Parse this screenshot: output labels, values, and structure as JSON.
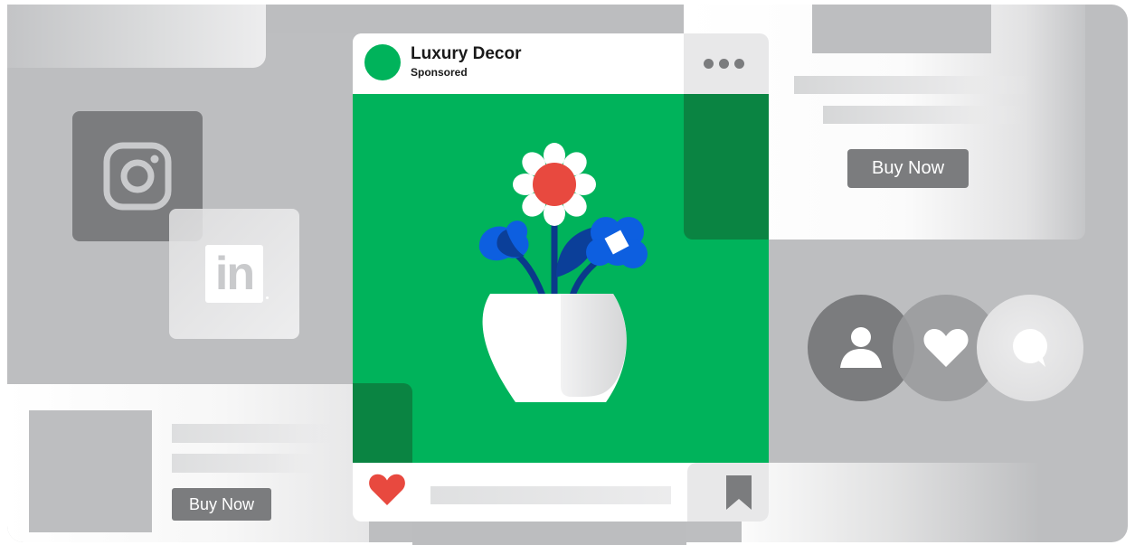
{
  "post": {
    "brand_name": "Luxury Decor",
    "sponsored_label": "Sponsored",
    "image_alt": "Flowers in a white vase",
    "actions": {
      "like_icon": "heart-icon",
      "save_icon": "bookmark-icon",
      "more_icon": "more-options-icon"
    }
  },
  "side_ads": {
    "top_right_button": "Buy Now",
    "bottom_left_button": "Buy Now"
  },
  "social_icons": {
    "instagram": "instagram-icon",
    "linkedin": "linkedin-icon",
    "linkedin_text": "in"
  },
  "reactions": [
    "user-icon",
    "heart-icon",
    "comment-icon"
  ],
  "colors": {
    "brand_green": "#00b35b",
    "dark_green": "#0a8442",
    "heart_red": "#e8493f",
    "flower_blue": "#0d5fe0",
    "neutral_grey": "#7b7c7e",
    "background_grey": "#bdbec0"
  }
}
